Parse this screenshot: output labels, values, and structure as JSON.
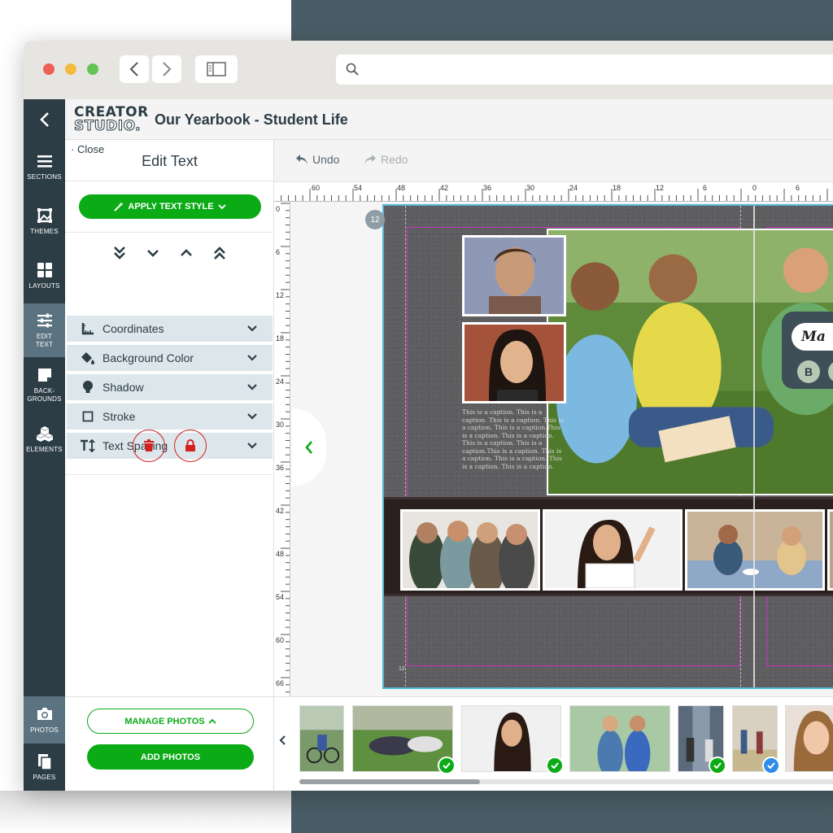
{
  "app": {
    "logo_line1": "CREATOR",
    "logo_line2": "STUDIO.",
    "project_title": "Our Yearbook - Student Life"
  },
  "rail": [
    {
      "label": "SECTIONS",
      "icon": "hamburger-icon"
    },
    {
      "label": "THEMES",
      "icon": "themes-icon"
    },
    {
      "label": "LAYOUTS",
      "icon": "layouts-grid-icon"
    },
    {
      "label": "EDIT\nTEXT",
      "icon": "sliders-icon",
      "active": true
    },
    {
      "label": "BACK-\nGROUNDS",
      "icon": "backgrounds-icon"
    },
    {
      "label": "ELEMENTS",
      "icon": "elements-cubes-icon"
    }
  ],
  "rail_bottom": [
    {
      "label": "PHOTOS",
      "icon": "camera-icon"
    },
    {
      "label": "PAGES",
      "icon": "pages-icon"
    }
  ],
  "panel": {
    "close_label": "Close",
    "title": "Edit Text",
    "apply_style_label": "APPLY TEXT STYLE",
    "accordions": [
      {
        "label": "Coordinates",
        "icon": "ruler-icon"
      },
      {
        "label": "Background Color",
        "icon": "paint-bucket-icon"
      },
      {
        "label": "Shadow",
        "icon": "shadow-bulb-icon"
      },
      {
        "label": "Stroke",
        "icon": "stroke-square-icon"
      },
      {
        "label": "Text Spacing",
        "icon": "text-spacing-icon"
      }
    ]
  },
  "toolbar": {
    "undo_label": "Undo",
    "redo_label": "Redo"
  },
  "rulers": {
    "h_labels": [
      "60",
      "54",
      "48",
      "42",
      "36",
      "30",
      "24",
      "18",
      "12",
      "6",
      "0",
      "6"
    ],
    "v_labels": [
      "0",
      "6",
      "12",
      "18",
      "24",
      "30",
      "36",
      "42",
      "48",
      "54",
      "60",
      "66"
    ]
  },
  "spread": {
    "page_badge": "12",
    "page_number": "12",
    "caption": "This is a caption. This is a caption. This is a caption. This is a caption. This is a caption.This is a caption. This is a caption. This is a caption. This is a caption.This is a caption. This is a caption. This is a caption. This is a caption. This is a caption."
  },
  "text_tool": {
    "font_preview": "Ma",
    "button_b": "B"
  },
  "photos": {
    "manage_label": "MANAGE PHOTOS",
    "add_label": "ADD PHOTOS"
  },
  "colors": {
    "primary_green": "#0bab16",
    "rail_dark": "#2c3d46",
    "selection_blue": "#4fb9d6",
    "margin_magenta": "#c534c5"
  }
}
